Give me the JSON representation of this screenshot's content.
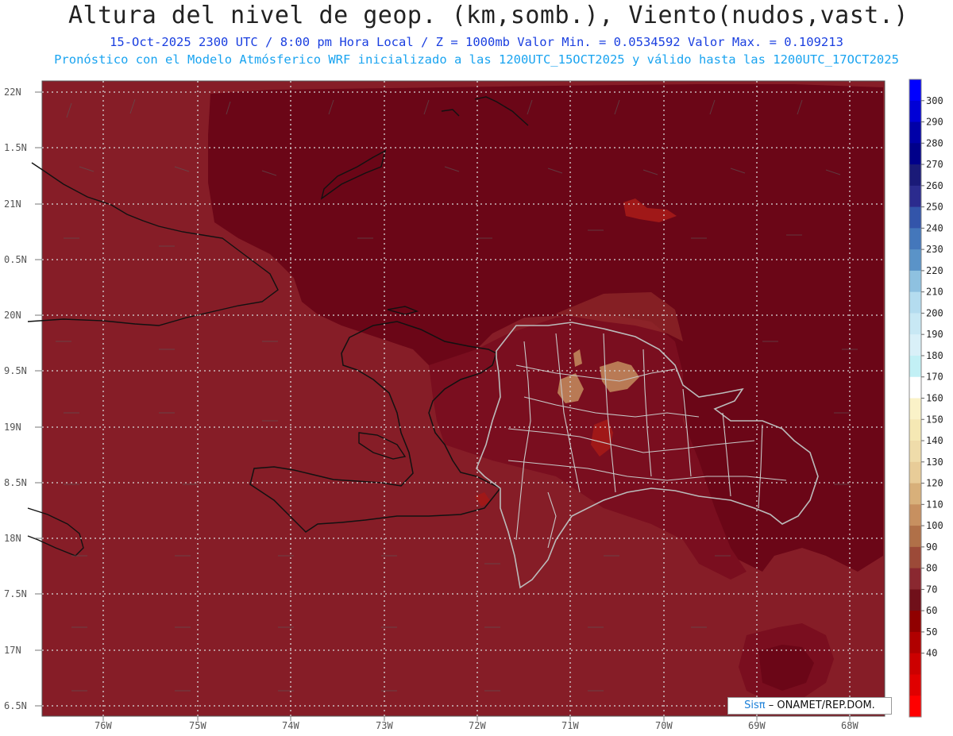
{
  "header": {
    "title": "Altura del nivel de geop. (km,somb.), Viento(nudos,vast.)",
    "subtitle_line1": "15-Oct-2025  2300 UTC / 8:00 pm Hora Local / Z = 1000mb  Valor Min. = 0.0534592  Valor Max. = 0.109213",
    "subtitle_line2": "Pronóstico con el Modelo Atmósferico WRF inicializado a las 1200UTC_15OCT2025 y válido hasta las  1200UTC_17OCT2025"
  },
  "axes": {
    "lat_labels": [
      "22N",
      "1.5N",
      "21N",
      "0.5N",
      "20N",
      "9.5N",
      "19N",
      "8.5N",
      "18N",
      "7.5N",
      "17N",
      "6.5N"
    ],
    "lon_labels": [
      "76W",
      "75W",
      "74W",
      "73W",
      "72W",
      "71W",
      "70W",
      "69W",
      "68W"
    ],
    "grid": "dotted",
    "lat_range": [
      16.5,
      22.0
    ],
    "lon_range": [
      -76.6,
      -67.6
    ]
  },
  "colorbar": {
    "labels": [
      "300",
      "290",
      "280",
      "270",
      "260",
      "250",
      "240",
      "230",
      "220",
      "210",
      "200",
      "190",
      "180",
      "170",
      "160",
      "150",
      "140",
      "130",
      "120",
      "110",
      "100",
      "90",
      "80",
      "70",
      "60",
      "50",
      "40"
    ],
    "colors": [
      "#0000ff",
      "#0000d6",
      "#0000a8",
      "#00008a",
      "#1a1a78",
      "#2b2b8e",
      "#3355aa",
      "#4477bb",
      "#5a93c8",
      "#8ec1e0",
      "#b4dcef",
      "#c8e8f4",
      "#d9f0f8",
      "#c2f0f5",
      "#ffffff",
      "#faf2c8",
      "#f5e8b4",
      "#efdcaa",
      "#e8cc98",
      "#d8b07a",
      "#c79060",
      "#b07048",
      "#9c4a38",
      "#8a2830",
      "#70101a",
      "#900000",
      "#b00000",
      "#cc0000",
      "#e00000",
      "#ff0000"
    ],
    "ticks": [
      "300",
      "290",
      "280",
      "270",
      "260",
      "250",
      "240",
      "230",
      "220",
      "210",
      "200",
      "190",
      "180",
      "170",
      "160",
      "150",
      "140",
      "130",
      "120",
      "110",
      "100",
      "90",
      "80",
      "70",
      "60",
      "50",
      "40"
    ]
  },
  "field_colors": {
    "base": "#861d27",
    "dark": "#6b0617",
    "mid": "#7a0e1f",
    "light": "#9a3430",
    "tan": "#b97a55",
    "red": "#a01818"
  },
  "credit": {
    "sis": "Sisπ",
    "text": "– ONAMET/REP.DOM."
  }
}
